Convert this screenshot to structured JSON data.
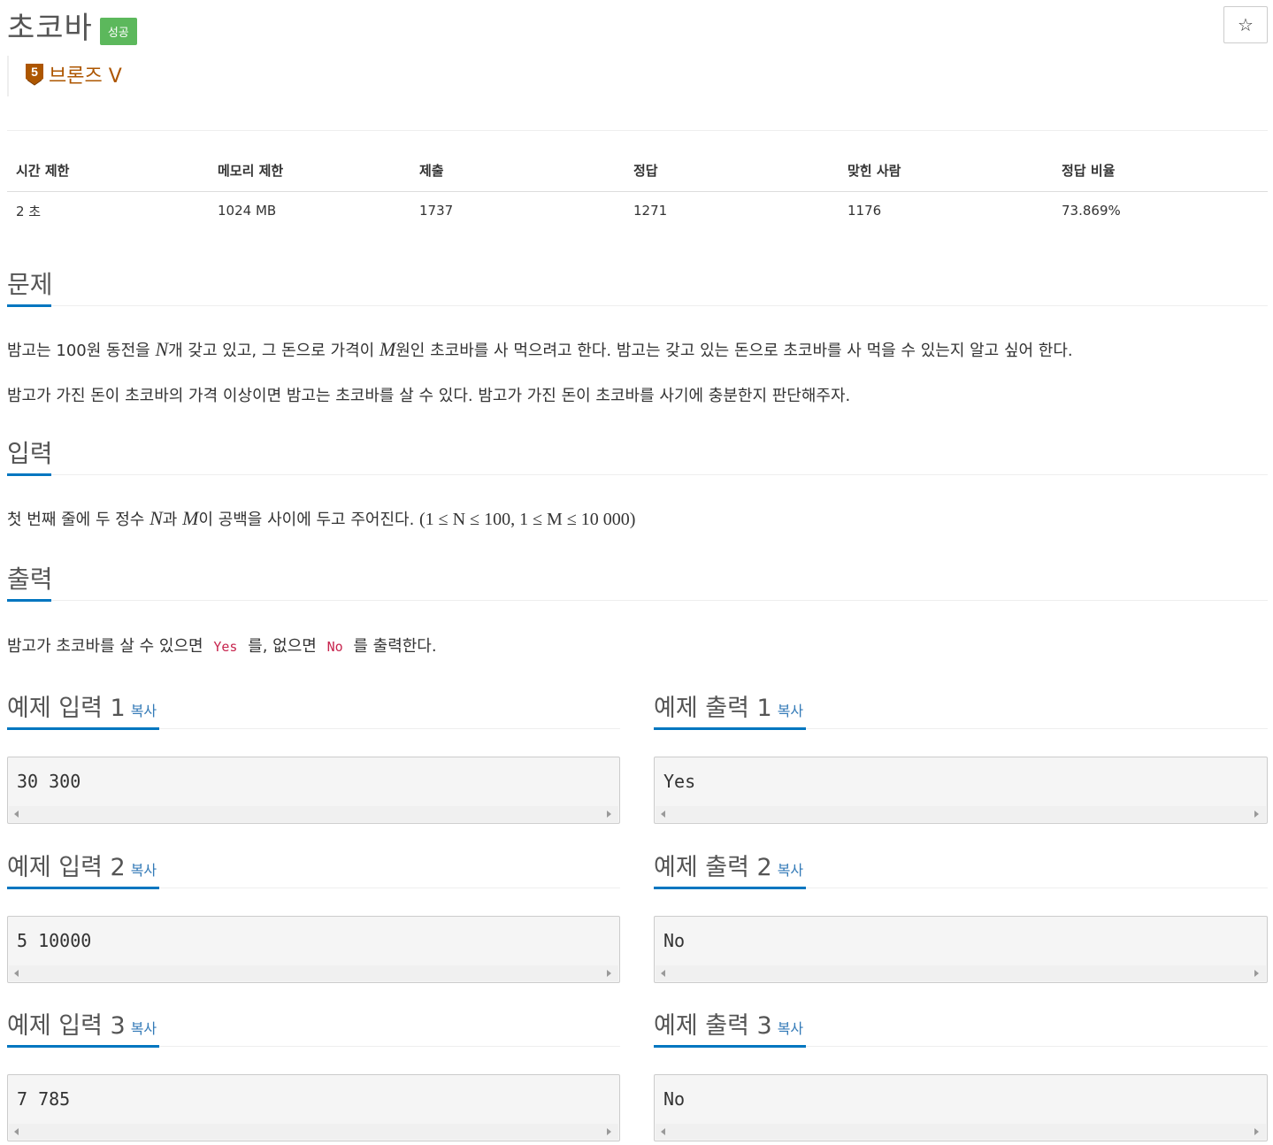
{
  "problem": {
    "title": "초코바",
    "status_badge": "성공",
    "tier_number": "5",
    "tier_label": "브론즈 V",
    "star_icon": "☆"
  },
  "colors": {
    "badge_success": "#5cb85c",
    "tier_bronze": "#ad5600",
    "accent": "#0076c0",
    "link": "#337ab7",
    "inline_code": "#c7254e"
  },
  "stats": {
    "headers": [
      "시간 제한",
      "메모리 제한",
      "제출",
      "정답",
      "맞힌 사람",
      "정답 비율"
    ],
    "values": [
      "2 초",
      "1024 MB",
      "1737",
      "1271",
      "1176",
      "73.869%"
    ]
  },
  "sections": {
    "description": {
      "heading": "문제",
      "p1_a": "밤고는 100원 동전을 ",
      "p1_var1": "N",
      "p1_b": "개 갖고 있고, 그 돈으로 가격이 ",
      "p1_var2": "M",
      "p1_c": "원인 초코바를 사 먹으려고 한다. 밤고는 갖고 있는 돈으로 초코바를 사 먹을 수 있는지 알고 싶어 한다.",
      "p2": "밤고가 가진 돈이 초코바의 가격 이상이면 밤고는 초코바를 살 수 있다. 밤고가 가진 돈이 초코바를 사기에 충분한지 판단해주자."
    },
    "input": {
      "heading": "입력",
      "p_a": "첫 번째 줄에 두 정수 ",
      "var1": "N",
      "p_b": "과 ",
      "var2": "M",
      "p_c": "이 공백을 사이에 두고 주어진다. ",
      "constraint": "(1 ≤ N ≤ 100, 1 ≤ M ≤ 10 000)"
    },
    "output": {
      "heading": "출력",
      "p_a": "밤고가 초코바를 살 수 있으면 ",
      "code_yes": "Yes",
      "p_b": " 를, 없으면 ",
      "code_no": "No",
      "p_c": " 를 출력한다."
    }
  },
  "samples": {
    "copy_label": "복사",
    "items": [
      {
        "in_title": "예제 입력 1",
        "in_value": "30 300",
        "out_title": "예제 출력 1",
        "out_value": "Yes"
      },
      {
        "in_title": "예제 입력 2",
        "in_value": "5 10000",
        "out_title": "예제 출력 2",
        "out_value": "No"
      },
      {
        "in_title": "예제 입력 3",
        "in_value": "7 785",
        "out_title": "예제 출력 3",
        "out_value": "No"
      }
    ]
  }
}
